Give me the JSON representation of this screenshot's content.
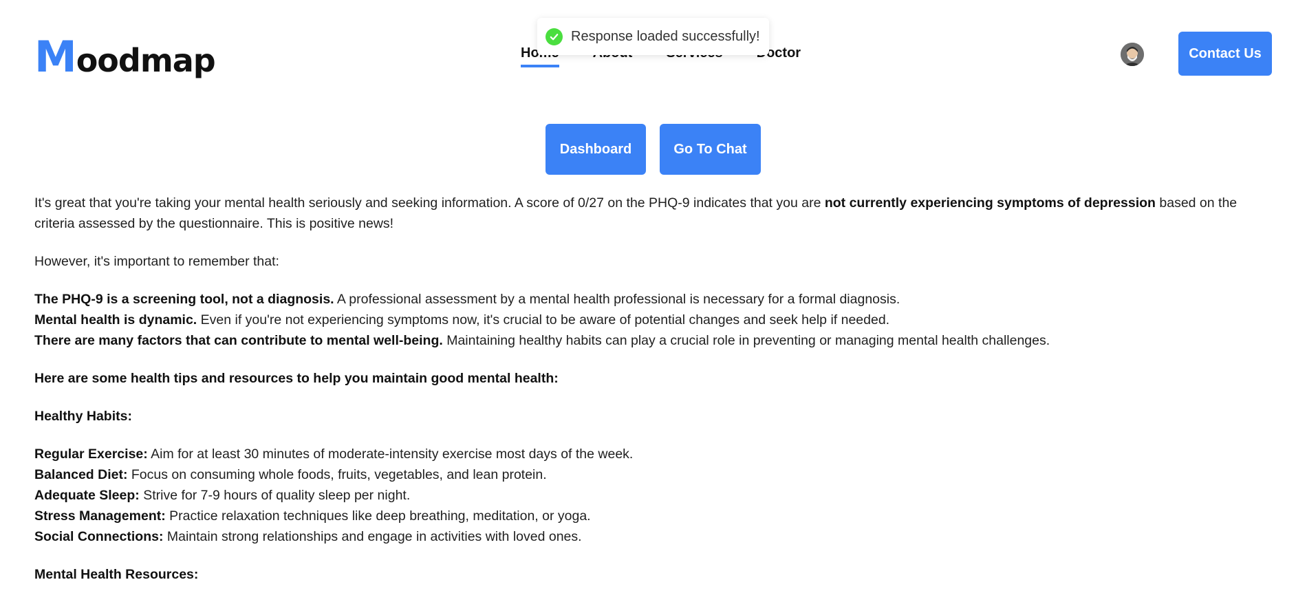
{
  "brand": {
    "first_letter": "M",
    "rest": "oodmap",
    "accent": "#3b82f6"
  },
  "nav": {
    "items": [
      {
        "label": "Home"
      },
      {
        "label": "About"
      },
      {
        "label": "Services"
      },
      {
        "label": "Doctor"
      }
    ]
  },
  "header": {
    "contact_label": "Contact Us"
  },
  "toast": {
    "message": "Response loaded successfully!",
    "icon": "check-circle-icon",
    "color": "#4ade3f"
  },
  "actions": {
    "dashboard_label": "Dashboard",
    "chat_label": "Go To Chat"
  },
  "content": {
    "intro": {
      "text1": "It's great that you're taking your mental health seriously and seeking information. A score of 0/27 on the PHQ-9 indicates that you are ",
      "bold": "not currently experiencing symptoms of depression",
      "text2": " based on the criteria assessed by the questionnaire. This is positive news!"
    },
    "however": "However, it's important to remember that:",
    "points": [
      {
        "bold": "The PHQ-9 is a screening tool, not a diagnosis.",
        "text": " A professional assessment by a mental health professional is necessary for a formal diagnosis."
      },
      {
        "bold": "Mental health is dynamic.",
        "text": " Even if you're not experiencing symptoms now, it's crucial to be aware of potential changes and seek help if needed."
      },
      {
        "bold": "There are many factors that can contribute to mental well-being.",
        "text": " Maintaining healthy habits can play a crucial role in preventing or managing mental health challenges."
      }
    ],
    "tips_heading": "Here are some health tips and resources to help you maintain good mental health:",
    "habits_heading": "Healthy Habits:",
    "habits": [
      {
        "bold": "Regular Exercise:",
        "text": " Aim for at least 30 minutes of moderate-intensity exercise most days of the week."
      },
      {
        "bold": "Balanced Diet:",
        "text": " Focus on consuming whole foods, fruits, vegetables, and lean protein."
      },
      {
        "bold": "Adequate Sleep:",
        "text": " Strive for 7-9 hours of quality sleep per night."
      },
      {
        "bold": "Stress Management:",
        "text": " Practice relaxation techniques like deep breathing, meditation, or yoga."
      },
      {
        "bold": "Social Connections:",
        "text": " Maintain strong relationships and engage in activities with loved ones."
      }
    ],
    "resources_heading": "Mental Health Resources:"
  }
}
